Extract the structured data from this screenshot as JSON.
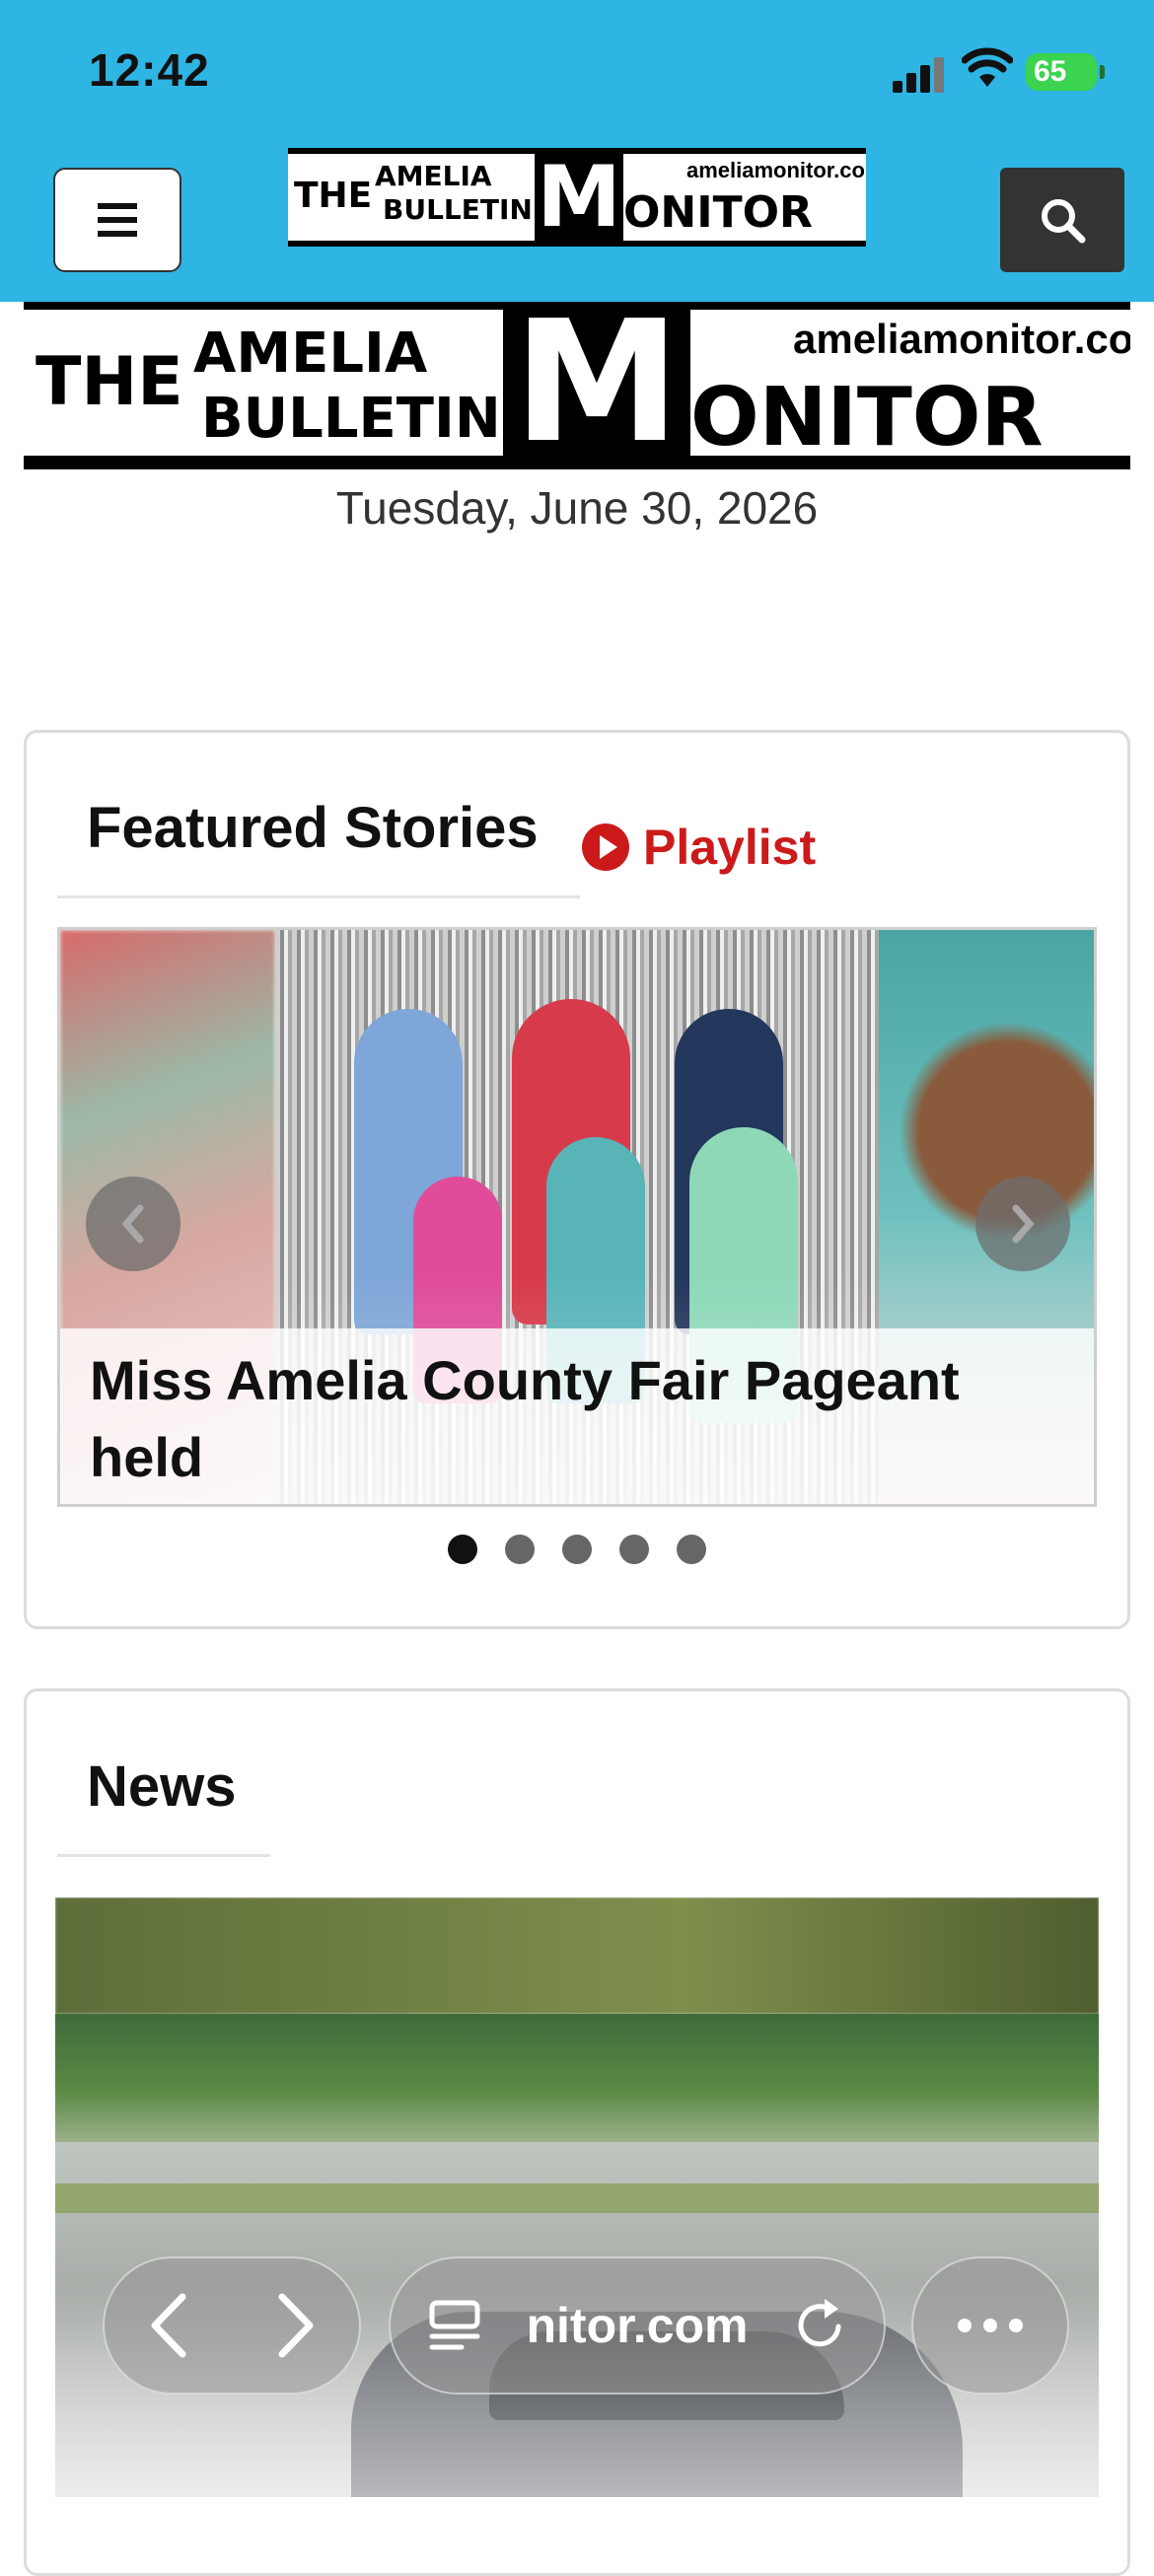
{
  "status_bar": {
    "time": "12:42",
    "battery": "65"
  },
  "header": {
    "logo": {
      "the": "THE",
      "amelia": "AMELIA",
      "bulletin": "BULLETIN",
      "m": "M",
      "onitor": "ONITOR",
      "site": "ameliamonitor.com"
    }
  },
  "date": "Tuesday, June 30, 2026",
  "featured": {
    "title": "Featured Stories",
    "playlist_label": "Playlist",
    "slide_caption": "Miss Amelia County Fair Pageant held",
    "dots": 5,
    "active_dot": 0
  },
  "news": {
    "title": "News"
  },
  "browser": {
    "url": "nitor.com"
  },
  "icons": [
    "hamburger-menu-icon",
    "search-icon",
    "play-icon",
    "chevron-left-icon",
    "chevron-right-icon",
    "tabs-icon",
    "reload-icon",
    "more-icon"
  ],
  "colors": {
    "header_bg": "#2eb5e3",
    "playlist": "#cc1a1a",
    "battery": "#3bd34f"
  }
}
